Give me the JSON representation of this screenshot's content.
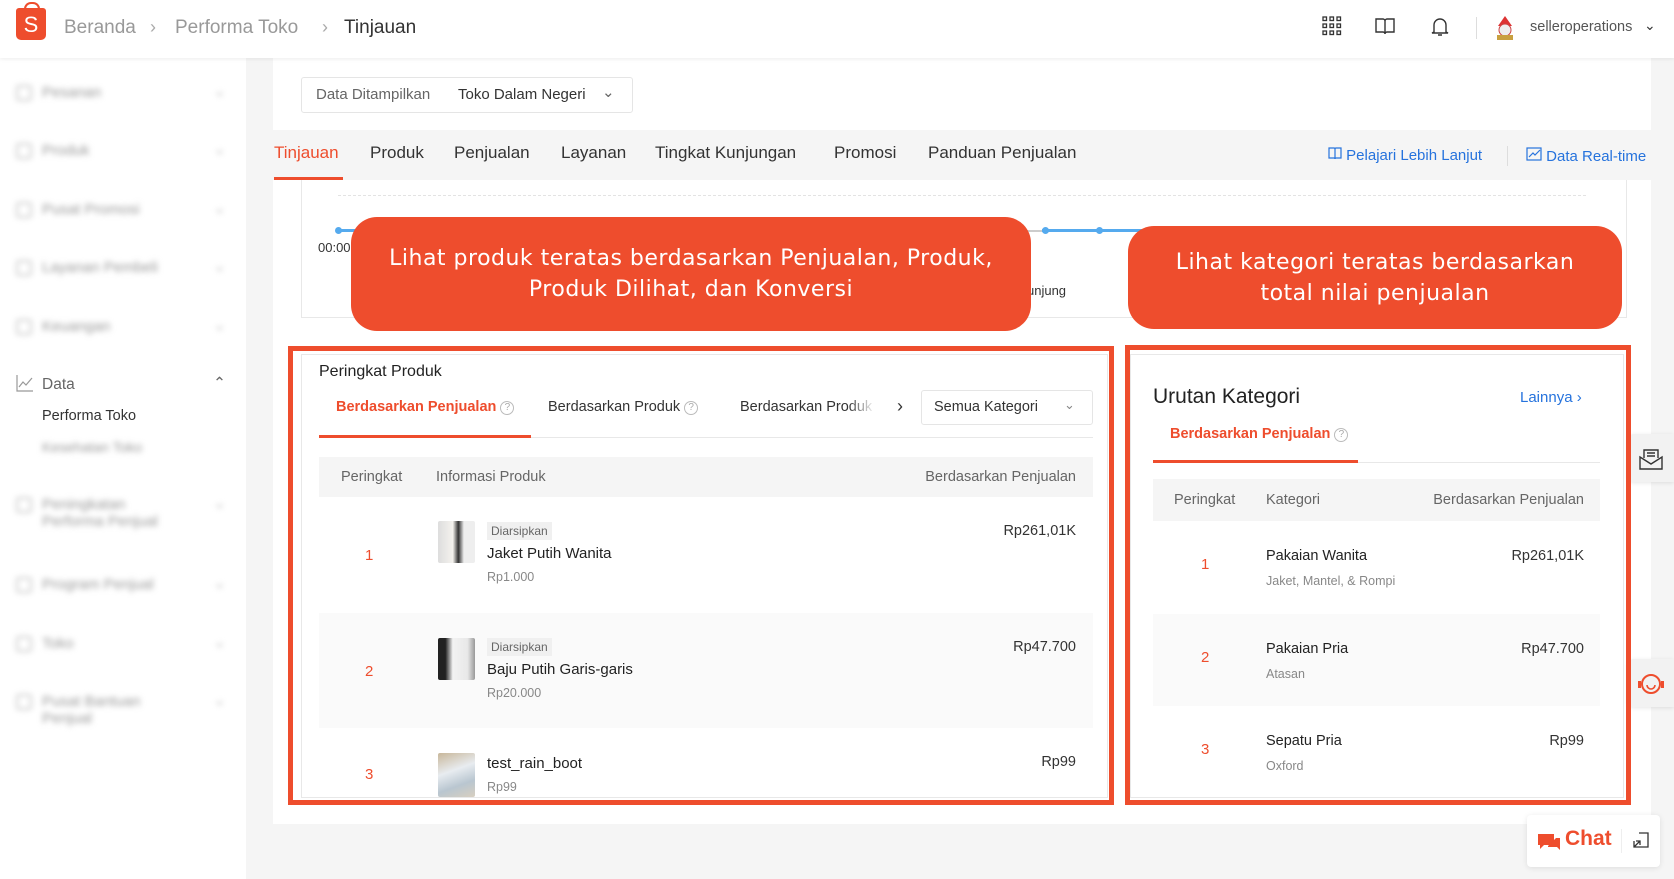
{
  "header": {
    "breadcrumb": [
      "Beranda",
      "Performa Toko",
      "Tinjauan"
    ],
    "username": "selleroperations",
    "icons": [
      "apps-grid-icon",
      "book-icon",
      "bell-icon"
    ]
  },
  "sidebar": {
    "section": "Data",
    "items": [
      "Performa Toko"
    ]
  },
  "filter": {
    "label": "Data Ditampilkan",
    "value": "Toko Dalam Negeri"
  },
  "tabs": [
    "Tinjauan",
    "Produk",
    "Penjualan",
    "Layanan",
    "Tingkat Kunjungan",
    "Promosi",
    "Panduan Penjualan"
  ],
  "links": {
    "learn_more": "Pelajari Lebih Lanjut",
    "realtime": "Data Real-time"
  },
  "chart": {
    "x_label": "00:00",
    "legend_fragment": "unjung"
  },
  "callouts": {
    "product": "Lihat produk teratas berdasarkan Penjualan, Produk, Produk Dilihat, dan Konversi",
    "category": "Lihat kategori teratas berdasarkan total nilai penjualan"
  },
  "product_rank": {
    "title": "Peringkat Produk",
    "subtabs": [
      "Berdasarkan Penjualan",
      "Berdasarkan Produk",
      "Berdasarkan Produk"
    ],
    "category_select": "Semua Kategori",
    "columns": [
      "Peringkat",
      "Informasi Produk",
      "Berdasarkan Penjualan"
    ],
    "rows": [
      {
        "rank": "1",
        "badge": "Diarsipkan",
        "name": "Jaket Putih Wanita",
        "price": "Rp1.000",
        "value": "Rp261,01K"
      },
      {
        "rank": "2",
        "badge": "Diarsipkan",
        "name": "Baju Putih Garis-garis",
        "price": "Rp20.000",
        "value": "Rp47.700"
      },
      {
        "rank": "3",
        "name": "test_rain_boot",
        "price": "Rp99",
        "value": "Rp99"
      }
    ]
  },
  "category_rank": {
    "title": "Urutan Kategori",
    "more": "Lainnya",
    "subtab": "Berdasarkan Penjualan",
    "columns": [
      "Peringkat",
      "Kategori",
      "Berdasarkan Penjualan"
    ],
    "rows": [
      {
        "rank": "1",
        "name": "Pakaian Wanita",
        "sub": "Jaket, Mantel, & Rompi",
        "value": "Rp261,01K"
      },
      {
        "rank": "2",
        "name": "Pakaian Pria",
        "sub": "Atasan",
        "value": "Rp47.700"
      },
      {
        "rank": "3",
        "name": "Sepatu Pria",
        "sub": "Oxford",
        "value": "Rp99"
      }
    ]
  },
  "chat": {
    "label": "Chat"
  },
  "colors": {
    "brand": "#ee4d2d",
    "link": "#2673dd"
  }
}
